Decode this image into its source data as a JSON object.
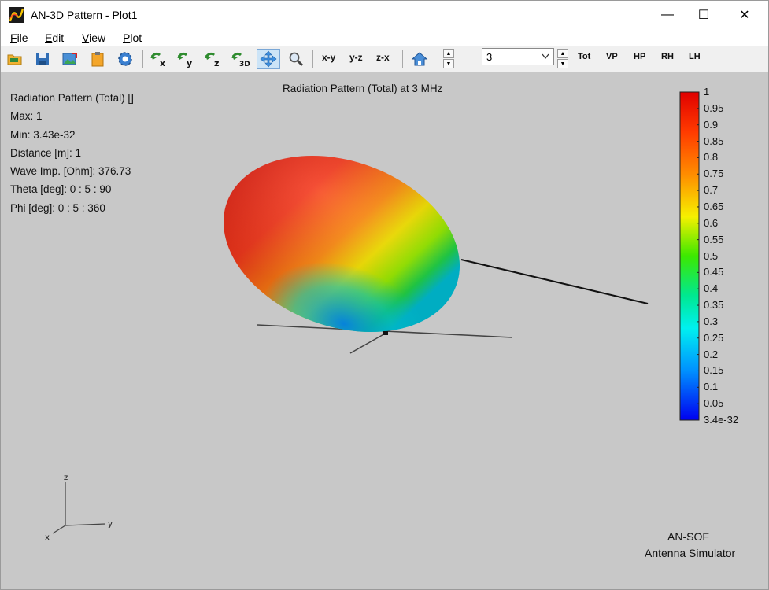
{
  "window": {
    "title": "AN-3D Pattern - Plot1",
    "min_glyph": "—",
    "max_glyph": "☐",
    "close_glyph": "✕"
  },
  "menu": [
    {
      "label": "File"
    },
    {
      "label": "Edit"
    },
    {
      "label": "View"
    },
    {
      "label": "Plot"
    }
  ],
  "toolbar": {
    "view_xy": "x-y",
    "view_yz": "y-z",
    "view_zx": "z-x",
    "frequency_value": "3",
    "pol_tot": "Tot",
    "pol_vp": "VP",
    "pol_hp": "HP",
    "pol_rh": "RH",
    "pol_lh": "LH",
    "rot_x_sub": "x",
    "rot_y_sub": "y",
    "rot_z_sub": "z",
    "rot_3d_sub": "3D"
  },
  "plot": {
    "title": "Radiation Pattern (Total) at 3 MHz",
    "info": [
      "Radiation Pattern (Total) []",
      "Max: 1",
      "Min: 3.43e-32",
      "Distance [m]: 1",
      "Wave Imp. [Ohm]: 376.73",
      "Theta [deg]: 0 : 5 : 90",
      "Phi [deg]: 0 : 5 : 360"
    ],
    "colorbar_labels": [
      "1",
      "0.95",
      "0.9",
      "0.85",
      "0.8",
      "0.75",
      "0.7",
      "0.65",
      "0.6",
      "0.55",
      "0.5",
      "0.45",
      "0.4",
      "0.35",
      "0.3",
      "0.25",
      "0.2",
      "0.15",
      "0.1",
      "0.05",
      "3.4e-32"
    ],
    "axes": {
      "z": "z",
      "y": "y",
      "x": "x"
    },
    "brand_line1": "AN-SOF",
    "brand_line2": "Antenna Simulator"
  },
  "colors": {
    "background": "#c8c8c8",
    "toolbar_bg": "#f0f0f0",
    "active_tool": "#cce4f7"
  }
}
